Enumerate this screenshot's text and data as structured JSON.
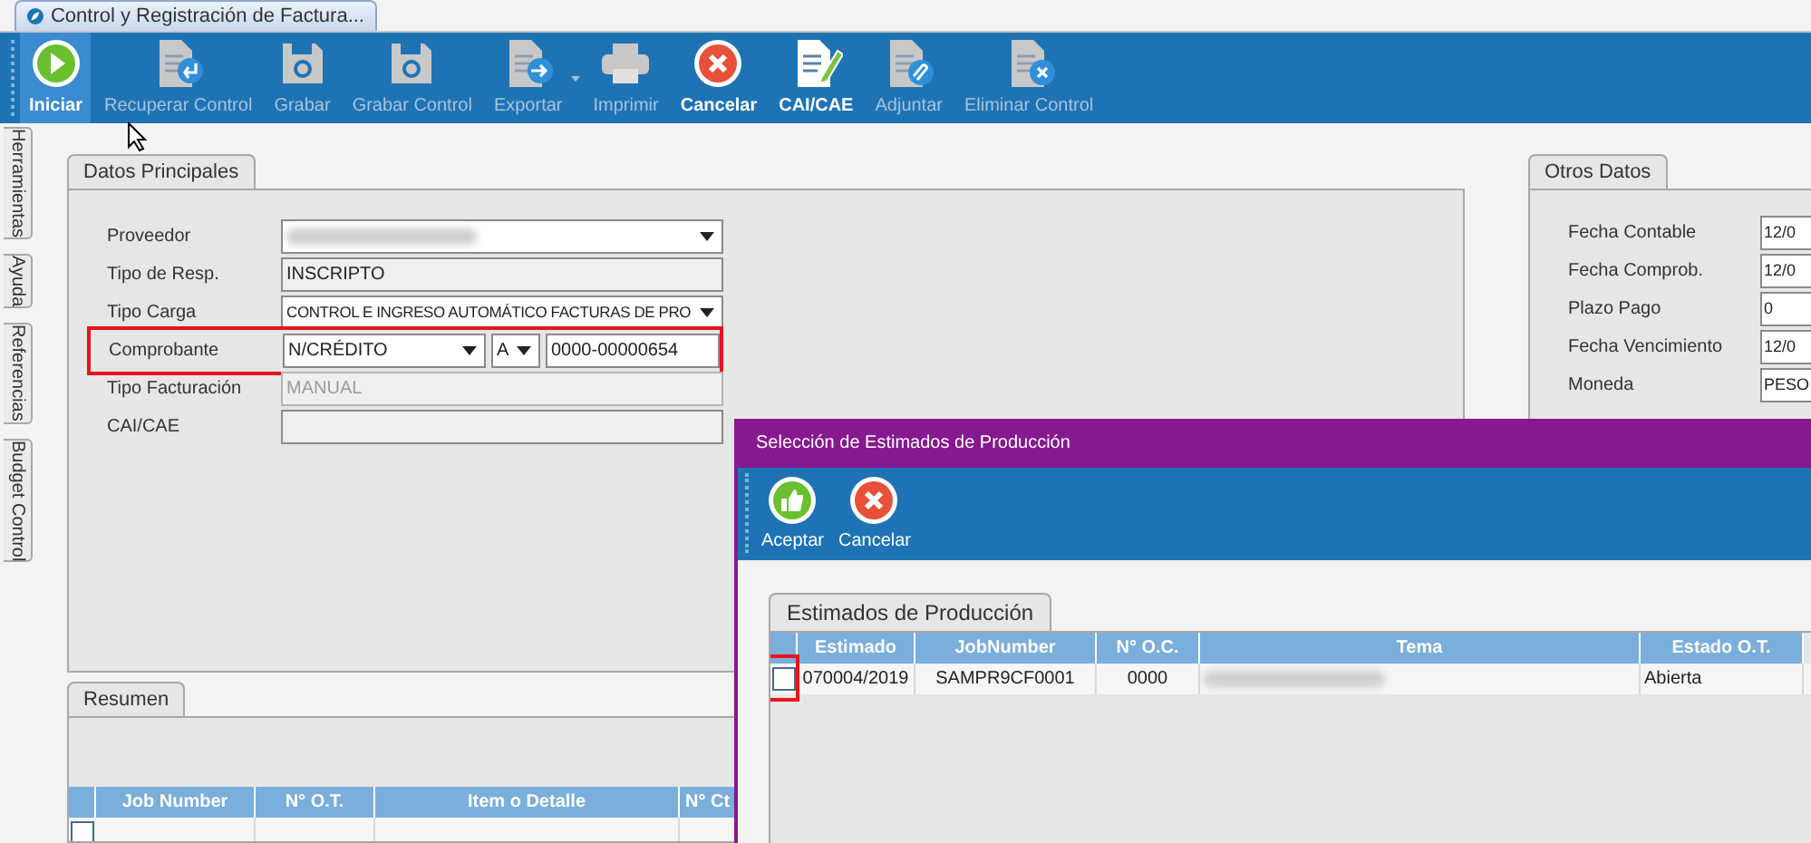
{
  "window_tab": {
    "title": "Control y Registración de Factura..."
  },
  "toolbar": [
    {
      "label": "Iniciar",
      "kind": "play",
      "disabled": false,
      "selected": true
    },
    {
      "label": "Recuperar Control",
      "kind": "doc-return",
      "disabled": true,
      "selected": false
    },
    {
      "label": "Grabar",
      "kind": "floppy",
      "disabled": true,
      "selected": false
    },
    {
      "label": "Grabar Control",
      "kind": "floppy",
      "disabled": true,
      "selected": false
    },
    {
      "label": "Exportar",
      "kind": "doc-export",
      "disabled": true,
      "selected": false
    },
    {
      "label": "Imprimir",
      "kind": "printer",
      "disabled": true,
      "selected": false
    },
    {
      "label": "Cancelar",
      "kind": "cancel",
      "disabled": false,
      "selected": false
    },
    {
      "label": "CAI/CAE",
      "kind": "doc-pencil",
      "disabled": false,
      "selected": false
    },
    {
      "label": "Adjuntar",
      "kind": "doc-clip",
      "disabled": true,
      "selected": false
    },
    {
      "label": "Eliminar Control",
      "kind": "doc-x",
      "disabled": true,
      "selected": false
    }
  ],
  "side_tabs": [
    "Herramientas",
    "Ayuda",
    "Referencias",
    "Budget Control"
  ],
  "datos_principales": {
    "tab": "Datos Principales",
    "fields": [
      {
        "label": "Proveedor",
        "kind": "dropdown",
        "redacted": true,
        "disabled": false
      },
      {
        "label": "Tipo de Resp.",
        "kind": "text",
        "value": "INSCRIPTO",
        "disabled": false
      },
      {
        "label": "Tipo Carga",
        "kind": "dropdown",
        "value": "CONTROL E INGRESO AUTOMÁTICO FACTURAS DE PRO",
        "disabled": false
      },
      {
        "label": "Comprobante",
        "kind": "comprobante",
        "highlighted": true,
        "type": "N/CRÉDITO",
        "letter": "A",
        "number": "0000-00000654",
        "disabled": false
      },
      {
        "label": "Tipo Facturación",
        "kind": "text",
        "value": "MANUAL",
        "disabled": true
      },
      {
        "label": "CAI/CAE",
        "kind": "text",
        "disabled": false
      }
    ]
  },
  "otros_datos": {
    "tab": "Otros Datos",
    "fields": [
      {
        "label": "Fecha Contable",
        "kind": "text",
        "value": "12/0"
      },
      {
        "label": "Fecha Comprob.",
        "kind": "text",
        "value": "12/0"
      },
      {
        "label": "Plazo Pago",
        "kind": "text",
        "value": "0"
      },
      {
        "label": "Fecha Vencimiento",
        "kind": "text",
        "value": "12/0"
      },
      {
        "label": "Moneda",
        "kind": "text",
        "value": "PESO"
      }
    ]
  },
  "resumen": {
    "tab": "Resumen",
    "columns": [
      "Job Number",
      "N° O.T.",
      "Item o Detalle",
      "N° Ct"
    ],
    "rows": [
      {
        "checked": false
      }
    ]
  },
  "dialog": {
    "title": "Selección de Estimados de Producción",
    "toolbar": [
      {
        "label": "Aceptar",
        "kind": "thumbs-up"
      },
      {
        "label": "Cancelar",
        "kind": "cancel"
      }
    ],
    "tab": "Estimados de Producción",
    "columns": [
      "Estimado",
      "JobNumber",
      "N° O.C.",
      "Tema",
      "Estado O.T."
    ],
    "rows": [
      {
        "checked": false,
        "highlighted": true,
        "cells": [
          "070004/2019",
          "SAMPR9CF0001",
          "0000",
          null,
          "Abierta"
        ]
      }
    ]
  }
}
